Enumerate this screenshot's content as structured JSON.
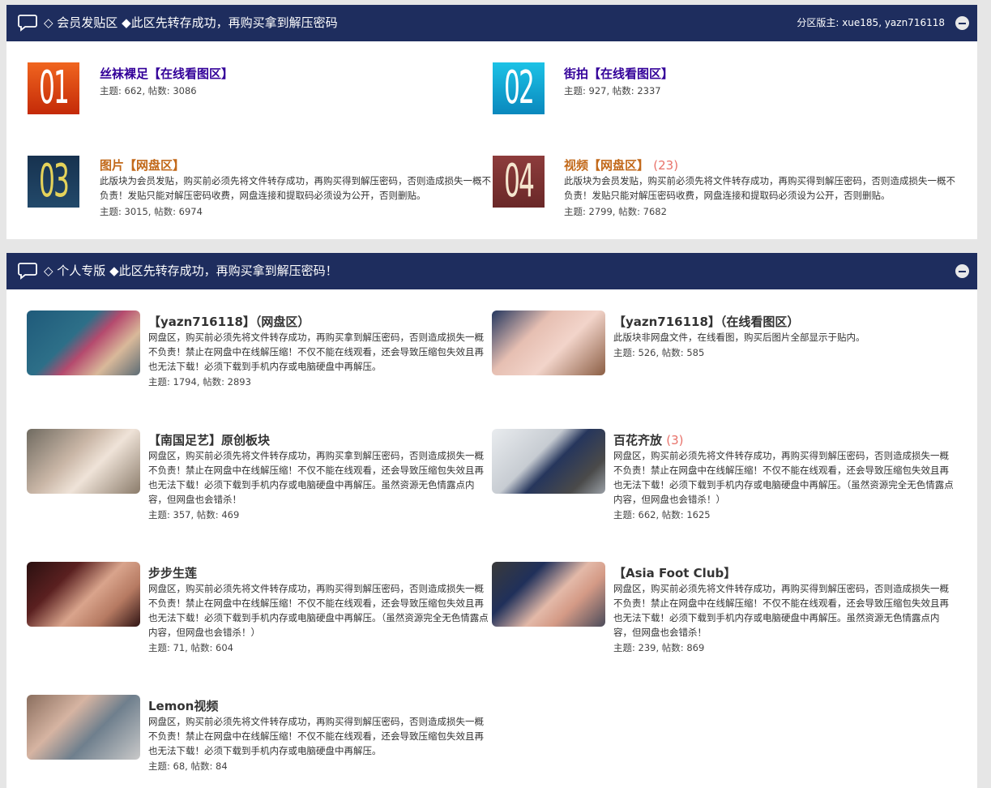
{
  "section1": {
    "title": "◇ 会员发贴区 ◆此区先转存成功，再购买拿到解压密码",
    "moderators": "分区版主: xue185, yazn716118",
    "forums": [
      {
        "icon_text": "01",
        "title": "丝袜裸足【在线看图区】",
        "stats": "主题: 662, 帖数: 3086"
      },
      {
        "icon_text": "02",
        "title": "街拍【在线看图区】",
        "stats": "主题: 927, 帖数: 2337"
      },
      {
        "icon_text": "03",
        "title": "图片【网盘区】",
        "desc": "此版块为会员发贴，购买前必须先将文件转存成功，再购买得到解压密码，否则造成损失一概不负责！发贴只能对解压密码收费，网盘连接和提取码必须设为公开，否则删贴。",
        "stats": "主题: 3015, 帖数: 6974"
      },
      {
        "icon_text": "04",
        "title": "视频【网盘区】",
        "count": "(23)",
        "desc": "此版块为会员发贴，购买前必须先将文件转存成功，再购买得到解压密码，否则造成损失一概不负责！发贴只能对解压密码收费，网盘连接和提取码必须设为公开，否则删贴。",
        "stats": "主题: 2799, 帖数: 7682"
      }
    ]
  },
  "section2": {
    "title": "◇ 个人专版 ◆此区先转存成功，再购买拿到解压密码！",
    "forums": [
      {
        "title": "【yazn716118】（网盘区）",
        "desc": "网盘区，购买前必须先将文件转存成功，再购买拿到解压密码，否则造成损失一概不负责！禁止在网盘中在线解压缩！不仅不能在线观看，还会导致压缩包失效且再也无法下载！必须下载到手机内存或电脑硬盘中再解压。",
        "stats": "主题: 1794, 帖数: 2893"
      },
      {
        "title": "【yazn716118】（在线看图区）",
        "desc": "此版块非网盘文件，在线看图，购买后图片全部显示于贴内。",
        "stats": "主题: 526, 帖数: 585"
      },
      {
        "title": "【南国足艺】原创板块",
        "desc": "网盘区，购买前必须先将文件转存成功，再购买拿到解压密码，否则造成损失一概不负责！禁止在网盘中在线解压缩！不仅不能在线观看，还会导致压缩包失效且再也无法下载！必须下载到手机内存或电脑硬盘中再解压。虽然资源无色情露点内容，但网盘也会错杀！",
        "stats": "主题: 357, 帖数: 469"
      },
      {
        "title": "百花齐放",
        "count": "(3)",
        "desc": "网盘区，购买前必须先将文件转存成功，再购买得到解压密码，否则造成损失一概不负责！禁止在网盘中在线解压缩！不仅不能在线观看，还会导致压缩包失效且再也无法下载！必须下载到手机内存或电脑硬盘中再解压。（虽然资源完全无色情露点内容，但网盘也会错杀！）",
        "stats": "主题: 662, 帖数: 1625"
      },
      {
        "title": "步步生莲",
        "desc": "网盘区，购买前必须先将文件转存成功，再购买得到解压密码，否则造成损失一概不负责！禁止在网盘中在线解压缩！不仅不能在线观看，还会导致压缩包失效且再也无法下载！必须下载到手机内存或电脑硬盘中再解压。（虽然资源完全无色情露点内容，但网盘也会错杀！）",
        "stats": "主题: 71, 帖数: 604"
      },
      {
        "title": "【Asia Foot Club】",
        "desc": "网盘区，购买前必须先将文件转存成功，再购买得到解压密码，否则造成损失一概不负责！禁止在网盘中在线解压缩！不仅不能在线观看，还会导致压缩包失效且再也无法下载！必须下载到手机内存或电脑硬盘中再解压。虽然资源无色情露点内容，但网盘也会错杀！",
        "stats": "主题: 239, 帖数: 869"
      },
      {
        "title": "Lemon视频",
        "desc": "网盘区，购买前必须先将文件转存成功，再购买得到解压密码，否则造成损失一概不负责！禁止在网盘中在线解压缩！不仅不能在线观看，还会导致压缩包失效且再也无法下载！必须下载到手机内存或电脑硬盘中再解压。",
        "stats": "主题: 68, 帖数: 84"
      }
    ]
  },
  "colors": {
    "header_bg": "#1e2d5e",
    "forum_link_purple": "#330099",
    "forum_link_orange": "#c2691a",
    "count_red": "#e8726a",
    "icon01": "#d6390d",
    "icon02": "#0aa4d0",
    "icon03": "#1c3a5a",
    "icon04": "#7c3232"
  }
}
